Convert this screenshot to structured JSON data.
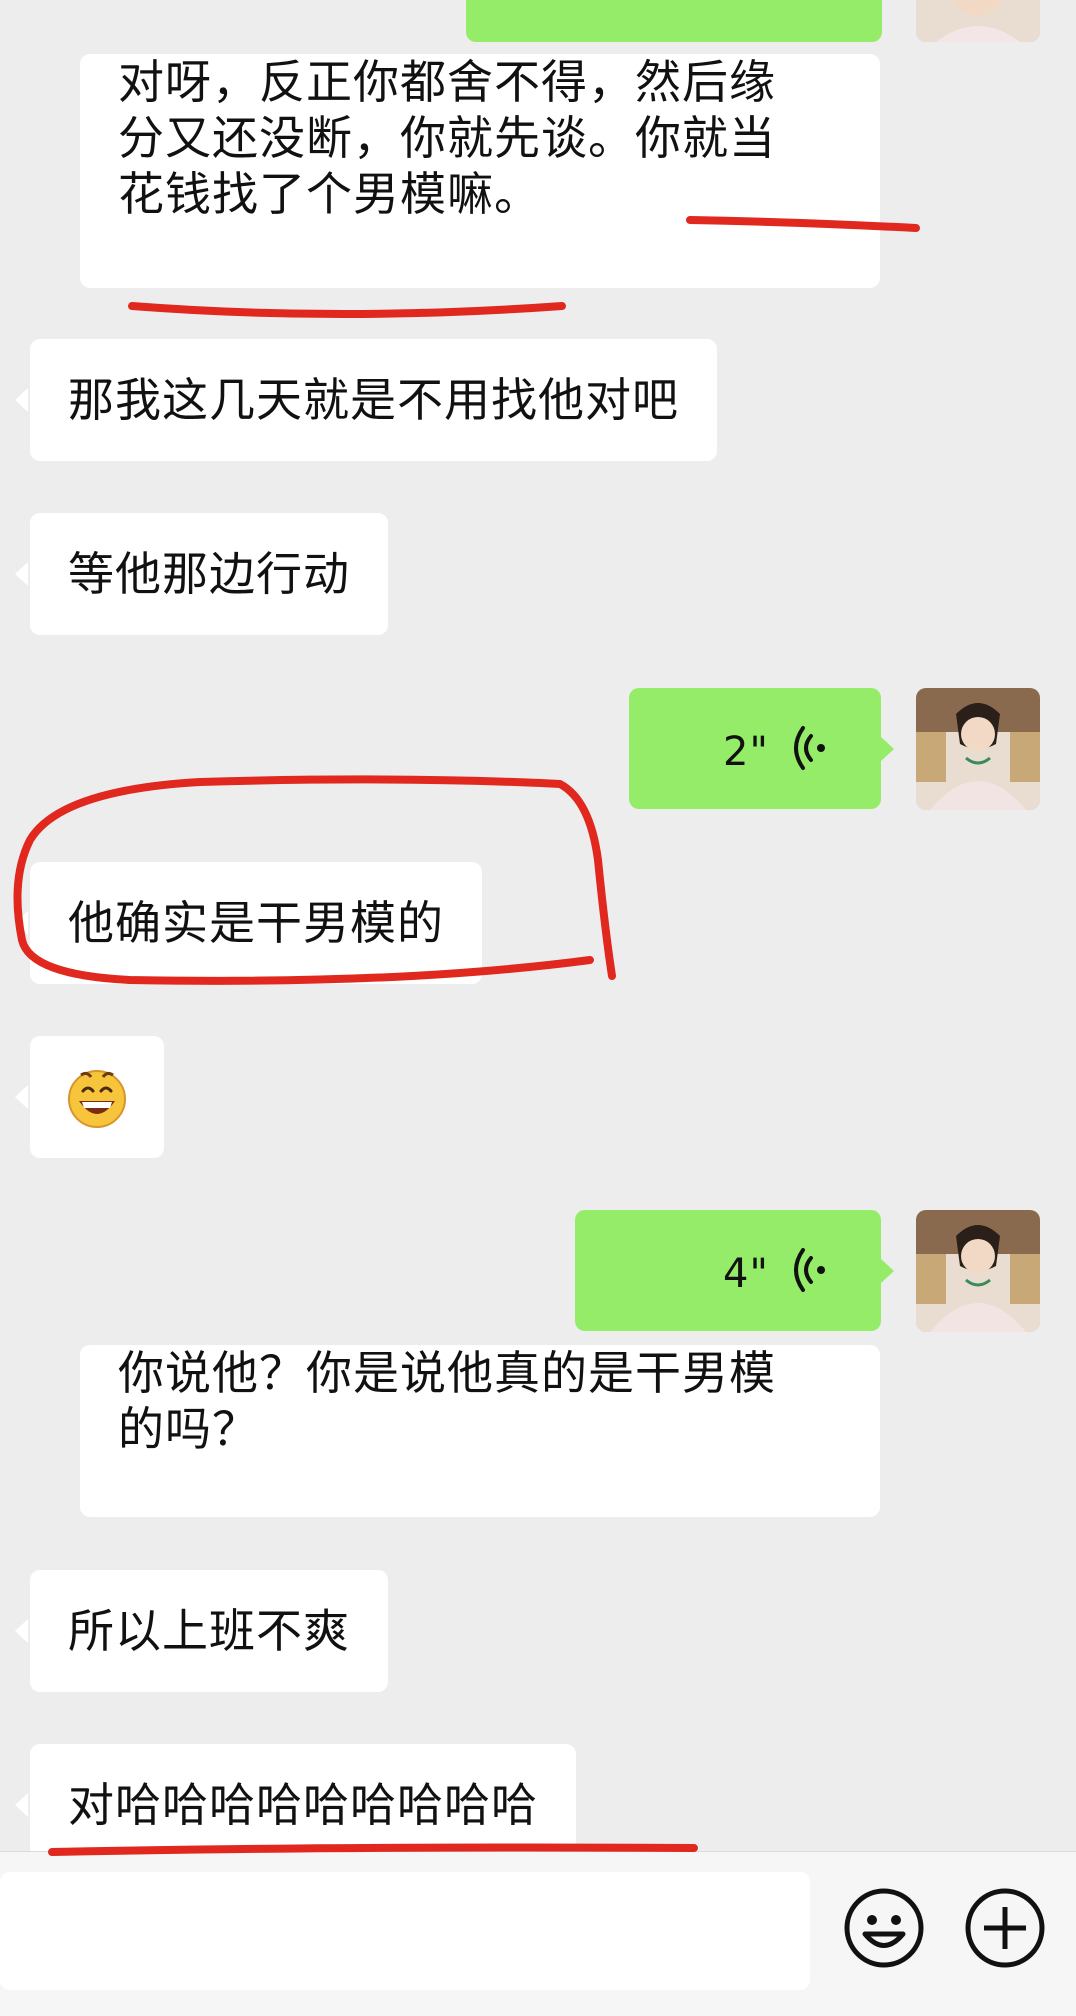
{
  "messages": [
    {
      "side": "right",
      "type": "text",
      "partial": true
    },
    {
      "side": "left",
      "type": "text",
      "lines": [
        "对呀，反正你都舍不得，然后缘",
        "分又还没断，你就先谈。你就当",
        "花钱找了个男模嘛。"
      ]
    },
    {
      "side": "left",
      "type": "text",
      "text": "那我这几天就是不用找他对吧"
    },
    {
      "side": "left",
      "type": "text",
      "text": "等他那边行动"
    },
    {
      "side": "right",
      "type": "voice",
      "duration": "2\""
    },
    {
      "side": "left",
      "type": "text",
      "text": "他确实是干男模的"
    },
    {
      "side": "left",
      "type": "emoji",
      "emoji": "😄",
      "emoji_name": "grinning-face-icon"
    },
    {
      "side": "right",
      "type": "voice",
      "duration": "4\""
    },
    {
      "side": "left",
      "type": "text",
      "lines": [
        "你说他？你是说他真的是干男模",
        "的吗？"
      ]
    },
    {
      "side": "left",
      "type": "text",
      "text": "所以上班不爽"
    },
    {
      "side": "left",
      "type": "text",
      "text": "对哈哈哈哈哈哈哈哈哈"
    }
  ],
  "input_bar": {
    "placeholder": "",
    "emoji_button_icon": "smiley-icon",
    "more_button_icon": "plus-circle-icon"
  },
  "colors": {
    "background": "#ededed",
    "bubble_left": "#ffffff",
    "bubble_right": "#95ec69",
    "annotation": "#e0281e"
  }
}
